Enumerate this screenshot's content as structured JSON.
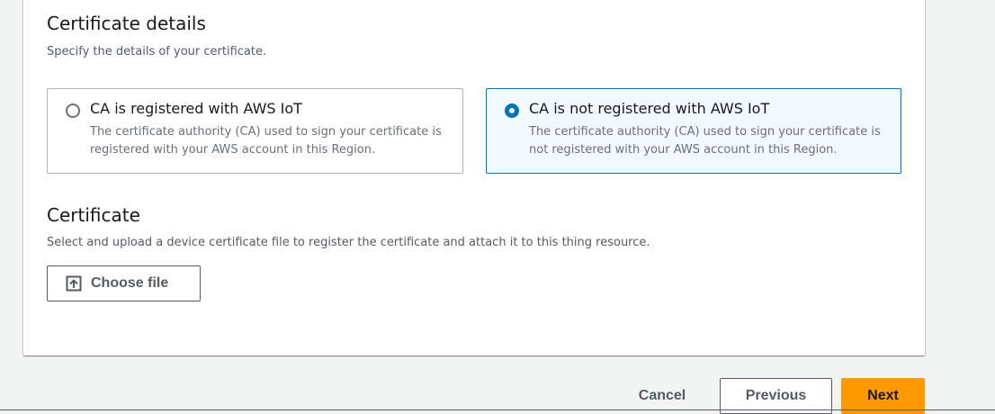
{
  "certificate_details": {
    "title": "Certificate details",
    "description": "Specify the details of your certificate.",
    "options": [
      {
        "label": "CA is registered with AWS IoT",
        "description": "The certificate authority (CA) used to sign your certificate is registered with your AWS account in this Region.",
        "selected": false
      },
      {
        "label": "CA is not registered with AWS IoT",
        "description": "The certificate authority (CA) used to sign your certificate is not registered with your AWS account in this Region.",
        "selected": true
      }
    ]
  },
  "certificate": {
    "title": "Certificate",
    "description": "Select and upload a device certificate file to register the certificate and attach it to this thing resource.",
    "choose_file_label": "Choose file",
    "choose_file_icon": "upload-icon"
  },
  "footer": {
    "cancel_label": "Cancel",
    "previous_label": "Previous",
    "next_label": "Next"
  },
  "colors": {
    "primary": "#ff9900",
    "selected_border": "#0073bb",
    "selected_background": "#f1faff"
  }
}
